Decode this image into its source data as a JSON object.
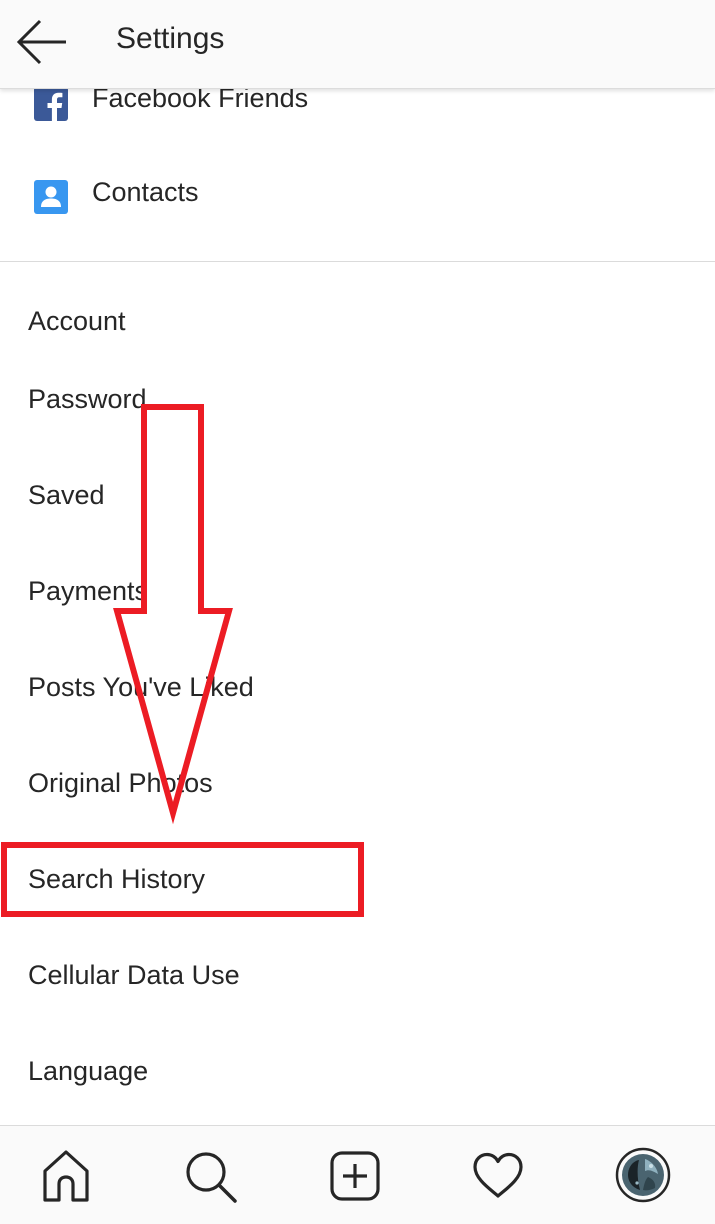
{
  "header": {
    "title": "Settings",
    "back_icon": "arrow-left-icon"
  },
  "follow_section": {
    "items": [
      {
        "label": "Facebook Friends",
        "icon": "facebook-icon",
        "icon_color": "#3b5998"
      },
      {
        "label": "Contacts",
        "icon": "contacts-person-icon",
        "icon_color": "#3897f0"
      }
    ]
  },
  "account": {
    "title": "Account",
    "items": [
      {
        "label": "Password"
      },
      {
        "label": "Saved"
      },
      {
        "label": "Payments"
      },
      {
        "label": "Posts You've Liked"
      },
      {
        "label": "Original Photos"
      },
      {
        "label": "Search History",
        "highlighted": true
      },
      {
        "label": "Cellular Data Use"
      },
      {
        "label": "Language"
      }
    ]
  },
  "annotation": {
    "color": "#ec1c24",
    "shape": "down-arrow-with-highlight-box"
  },
  "bottom_nav": {
    "items": [
      {
        "icon": "home-icon"
      },
      {
        "icon": "search-icon"
      },
      {
        "icon": "add-post-icon"
      },
      {
        "icon": "heart-icon"
      },
      {
        "icon": "profile-avatar"
      }
    ]
  }
}
